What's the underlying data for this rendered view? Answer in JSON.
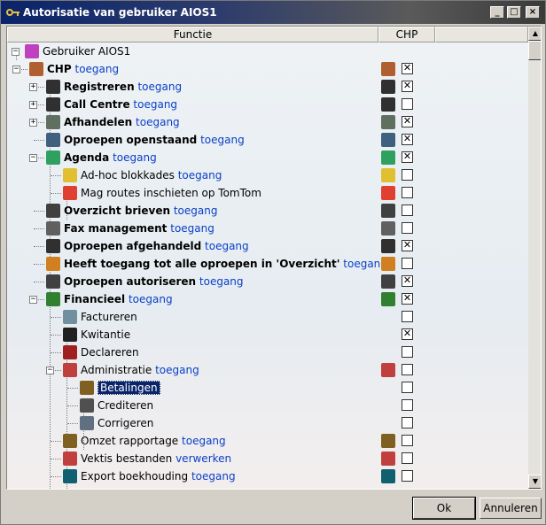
{
  "window": {
    "title": "Autorisatie van gebruiker AIOS1"
  },
  "columns": {
    "functie": "Functie",
    "chp": "CHP"
  },
  "tree": {
    "root": "Gebruiker AIOS1",
    "chp": {
      "name": "CHP",
      "link": "toegang"
    },
    "items": {
      "registreren": {
        "name": "Registreren",
        "link": "toegang"
      },
      "callcentre": {
        "name": "Call Centre",
        "link": "toegang"
      },
      "afhandelen": {
        "name": "Afhandelen",
        "link": "toegang"
      },
      "openstaand": {
        "name": "Oproepen openstaand",
        "link": "toegang"
      },
      "agenda": {
        "name": "Agenda",
        "link": "toegang"
      },
      "adhoc": {
        "name": "Ad-hoc blokkades",
        "link": "toegang"
      },
      "tomtom": {
        "name": "Mag routes inschieten op TomTom"
      },
      "brieven": {
        "name": "Overzicht brieven",
        "link": "toegang"
      },
      "fax": {
        "name": "Fax management",
        "link": "toegang"
      },
      "afgehandeld": {
        "name": "Oproepen afgehandeld",
        "link": "toegang"
      },
      "alleoproepen": {
        "name": "Heeft toegang tot alle oproepen in 'Overzicht'",
        "link": "toegang"
      },
      "autoriseren": {
        "name": "Oproepen autoriseren",
        "link": "toegang"
      },
      "financieel": {
        "name": "Financieel",
        "link": "toegang"
      },
      "factureren": {
        "name": "Factureren"
      },
      "kwitantie": {
        "name": "Kwitantie"
      },
      "declareren": {
        "name": "Declareren"
      },
      "administratie": {
        "name": "Administratie",
        "link": "toegang"
      },
      "betalingen": {
        "name": "Betalingen"
      },
      "crediteren": {
        "name": "Crediteren"
      },
      "corrigeren": {
        "name": "Corrigeren"
      },
      "omzet": {
        "name": "Omzet rapportage",
        "link": "toegang"
      },
      "vektis": {
        "name": "Vektis bestanden",
        "link": "verwerken"
      },
      "export": {
        "name": "Export boekhouding",
        "link": "toegang"
      }
    },
    "checked": {
      "chp": true,
      "registreren": true,
      "callcentre": false,
      "afhandelen": true,
      "openstaand": true,
      "agenda": true,
      "adhoc": false,
      "tomtom": false,
      "brieven": false,
      "fax": false,
      "afgehandeld": true,
      "alleoproepen": false,
      "autoriseren": true,
      "financieel": true,
      "factureren": false,
      "kwitantie": true,
      "declareren": false,
      "administratie": false,
      "betalingen": false,
      "crediteren": false,
      "corrigeren": false,
      "omzet": false,
      "vektis": false,
      "export": false
    }
  },
  "buttons": {
    "ok": "Ok",
    "cancel": "Annuleren"
  },
  "colors": {
    "link": "#0a40c8",
    "selection": "#0a246a"
  }
}
